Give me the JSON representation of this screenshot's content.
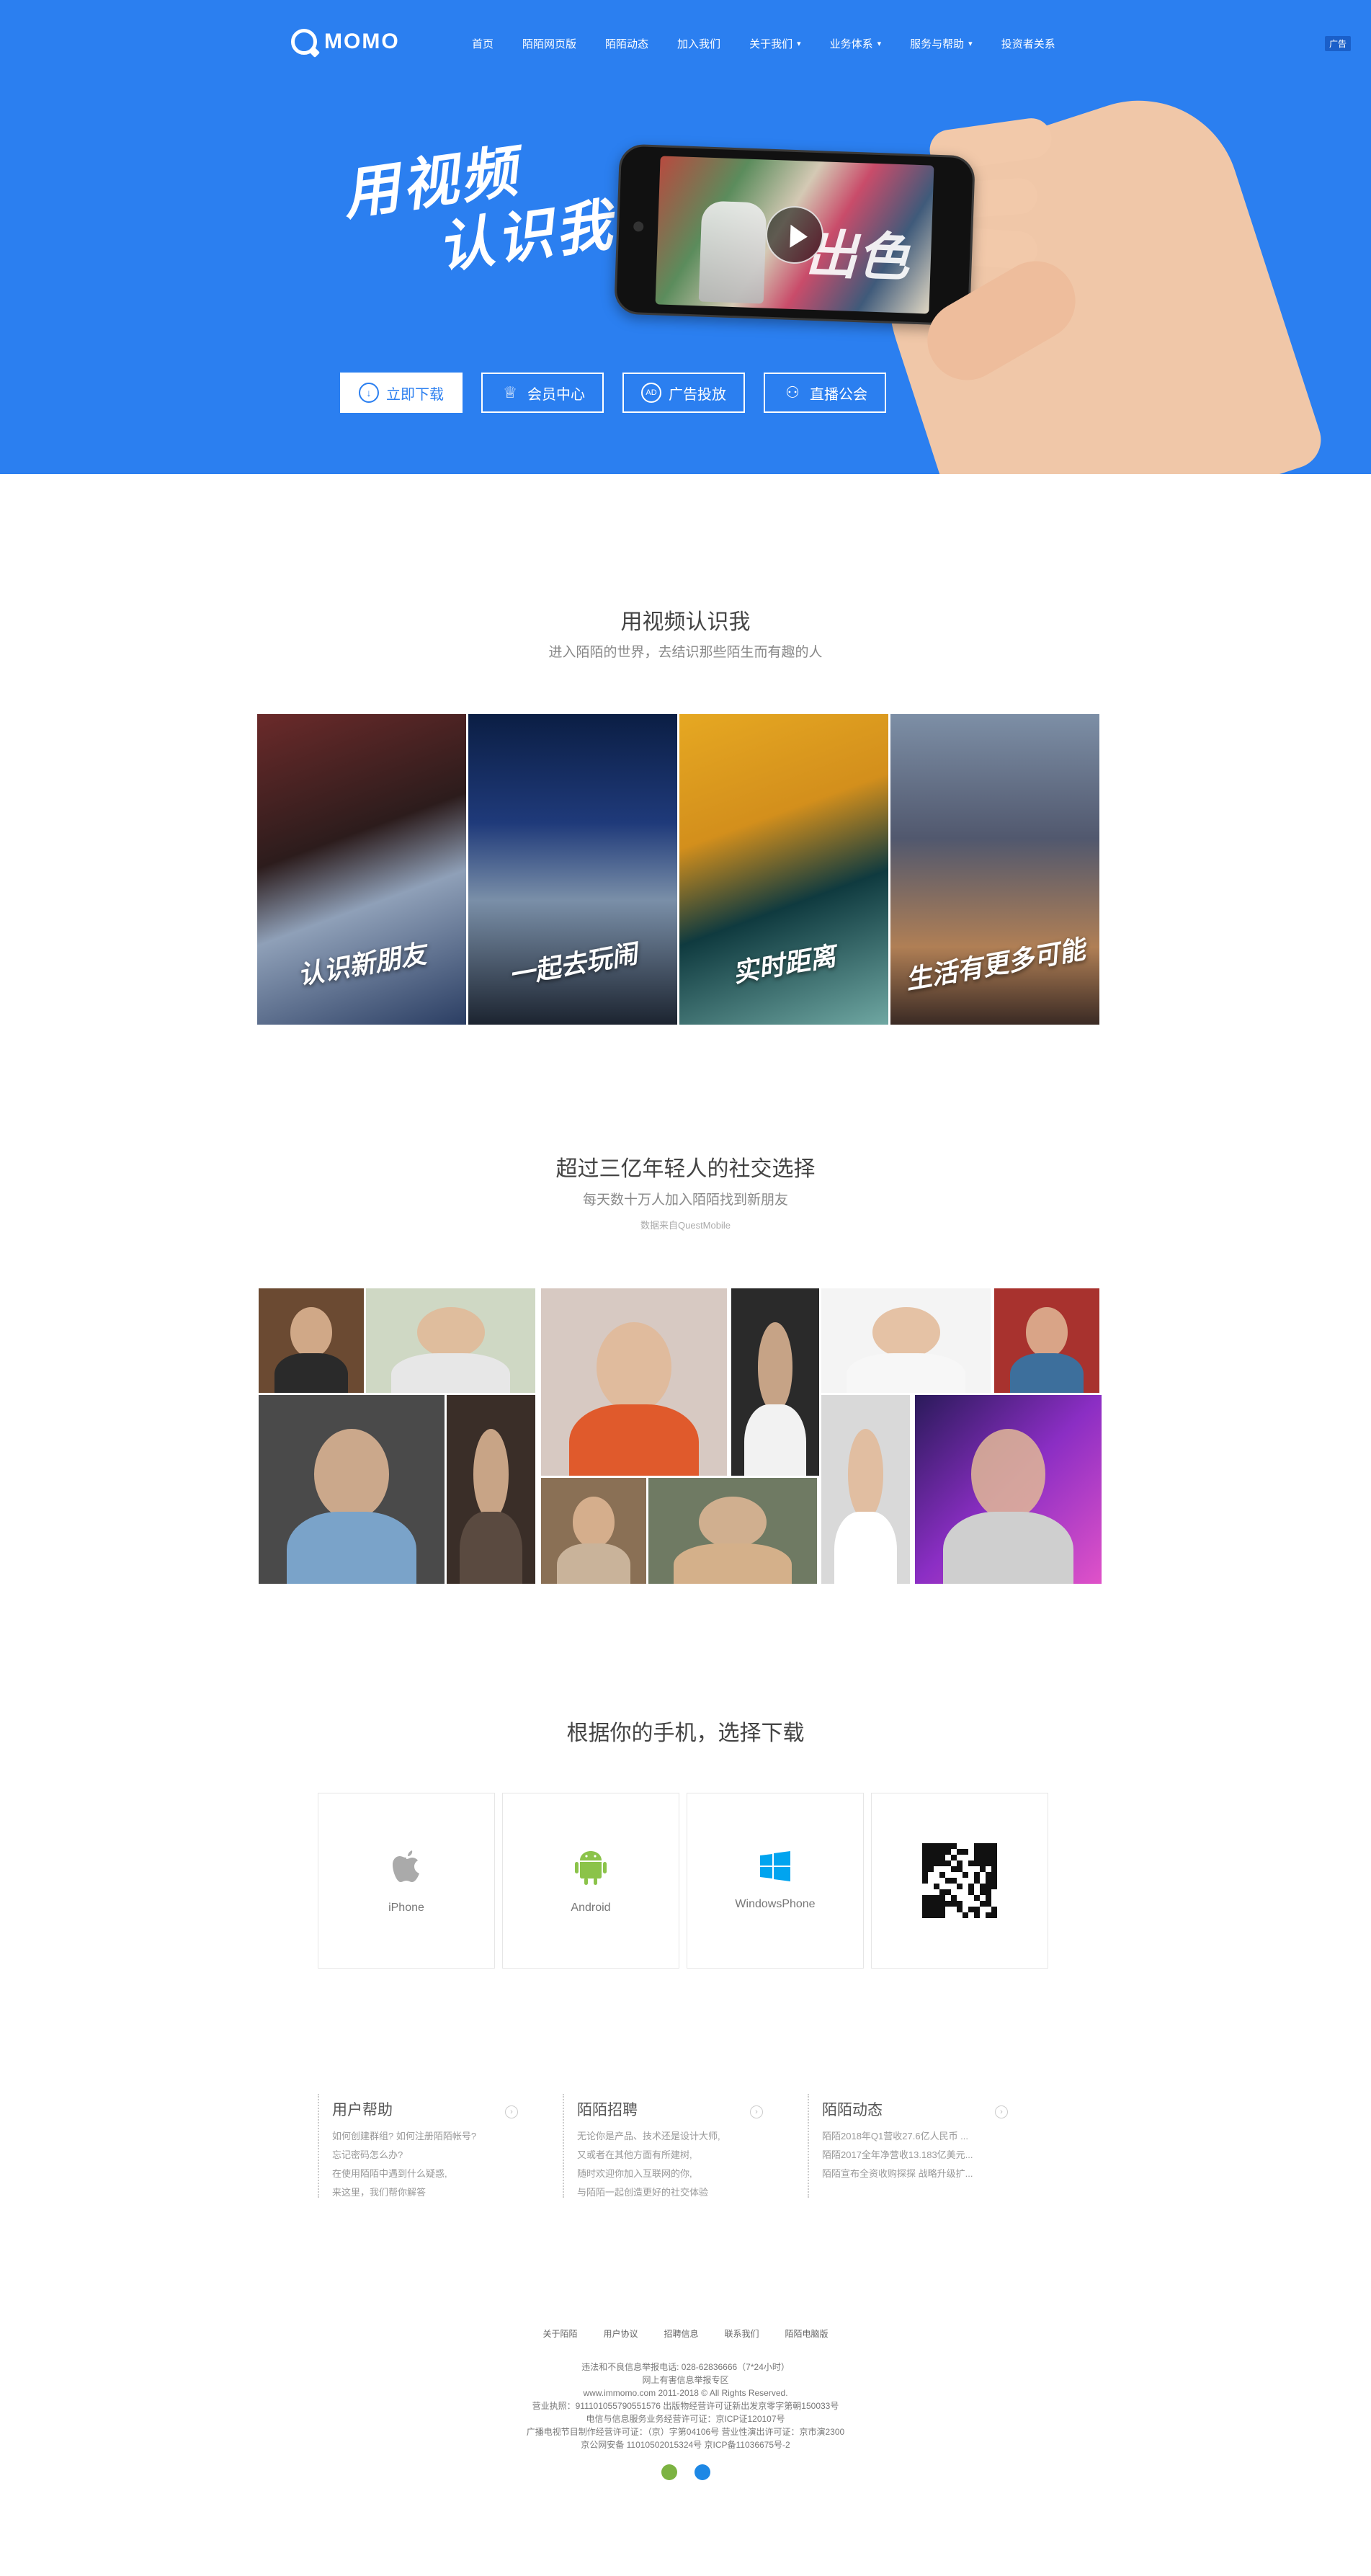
{
  "colors": {
    "brand": "#2b7ff0",
    "white": "#ffffff",
    "android": "#8bc34a",
    "windows": "#00a4ef",
    "apple": "#aaaaaa"
  },
  "header": {
    "logo_text": "MOMO",
    "nav": [
      {
        "label": "首页"
      },
      {
        "label": "陌陌网页版"
      },
      {
        "label": "陌陌动态"
      },
      {
        "label": "加入我们"
      },
      {
        "label": "关于我们",
        "dropdown": true
      },
      {
        "label": "业务体系",
        "dropdown": true
      },
      {
        "label": "服务与帮助",
        "dropdown": true
      },
      {
        "label": "投资者关系"
      }
    ],
    "ad_badge": "广告"
  },
  "hero": {
    "slogan_line1": "用视频",
    "slogan_line2": "认识我",
    "screen_text": "出色",
    "buttons": [
      {
        "label": "立即下载",
        "icon": "download-icon"
      },
      {
        "label": "会员中心",
        "icon": "crown-icon"
      },
      {
        "label": "广告投放",
        "icon": "ad-icon"
      },
      {
        "label": "直播公会",
        "icon": "user-icon"
      }
    ]
  },
  "section_video": {
    "title": "用视频认识我",
    "subtitle": "进入陌陌的世界，去结识那些陌生而有趣的人",
    "features": [
      {
        "caption": "认识新朋友"
      },
      {
        "caption": "一起去玩闹"
      },
      {
        "caption": "实时距离"
      },
      {
        "caption": "生活有更多可能"
      }
    ]
  },
  "section_users": {
    "title": "超过三亿年轻人的社交选择",
    "subtitle": "每天数十万人加入陌陌找到新朋友",
    "note": "数据来自QuestMobile"
  },
  "section_download": {
    "title": "根据你的手机，选择下载",
    "platforms": [
      {
        "label": "iPhone",
        "icon": "apple-icon"
      },
      {
        "label": "Android",
        "icon": "android-icon"
      },
      {
        "label": "WindowsPhone",
        "icon": "windows-icon"
      },
      {
        "label": "",
        "icon": "qr-code-icon"
      }
    ]
  },
  "help": [
    {
      "title": "用户帮助",
      "lines": [
        "如何创建群组? 如何注册陌陌帐号?",
        "忘记密码怎么办?",
        "在使用陌陌中遇到什么疑惑,",
        "来这里，我们帮你解答"
      ]
    },
    {
      "title": "陌陌招聘",
      "lines": [
        "无论你是产品、技术还是设计大师,",
        "又或者在其他方面有所建树,",
        "随时欢迎你加入互联网的你,",
        "与陌陌一起创造更好的社交体验"
      ]
    },
    {
      "title": "陌陌动态",
      "lines": [
        "陌陌2018年Q1营收27.6亿人民币 ...",
        "陌陌2017全年净营收13.183亿美元...",
        "陌陌宣布全资收购探探 战略升级扩..."
      ]
    }
  ],
  "footer": {
    "links": [
      "关于陌陌",
      "用户协议",
      "招聘信息",
      "联系我们",
      "陌陌电脑版"
    ],
    "legal": [
      "违法和不良信息举报电话: 028-62836666（7*24小时）",
      "网上有害信息举报专区",
      "www.immomo.com 2011-2018 © All Rights Reserved.",
      "营业执照：91110105579055157​6   出版物经营许可证新出发京零字第朝150033号",
      "电信与信息服务业务经营许可证：京ICP证120107号",
      "广播电视节目制作经营许可证：（京）字第04106号   营业性演出许可证：京市演2300",
      "京公网安备 11010502015324号   京ICP备11036675号-2"
    ]
  }
}
